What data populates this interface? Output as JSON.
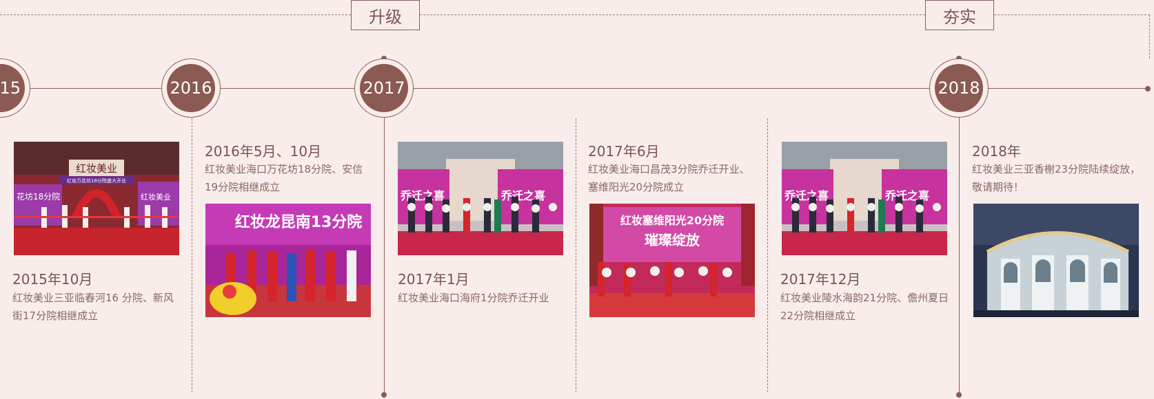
{
  "phases": [
    {
      "label": "升级"
    },
    {
      "label": "夯实"
    }
  ],
  "years": [
    "15",
    "2016",
    "2017",
    "2018"
  ],
  "events": [
    {
      "date": "2015年10月",
      "desc": "红妆美业三亚临春河16 分院、新风街17分院相继成立"
    },
    {
      "date": "2016年5月、10月",
      "desc": "红妆美业海口万花坊18分院、安信19分院相继成立"
    },
    {
      "date": "2017年1月",
      "desc": "红妆美业海口海府1分院乔迁开业"
    },
    {
      "date": "2017年6月",
      "desc": "红妆美业海口昌茂3分院乔迁开业、塞维阳光20分院成立"
    },
    {
      "date": "2017年12月",
      "desc": "红妆美业陵水海韵21分院、儋州夏日22分院相继成立"
    },
    {
      "date": "2018年",
      "desc": "红妆美业三亚香榭23分院陆续绽放，敬请期待！"
    }
  ],
  "photo_text": {
    "p2015_sign": "红妆美业",
    "p2015_banner": "红妆万花坊18分院盛大开业",
    "p2015_left": "花坊18分院",
    "p2015_right": "红妆美业",
    "p2016_banner": "红妆龙昆南13分院",
    "p2017a_left": "乔迁之喜",
    "p2017a_right": "乔迁之喜",
    "p2017b_banner": "红妆塞维阳光20分院",
    "p2017b_sub": "璀璨绽放",
    "p2017c_left": "乔迁之喜",
    "p2017c_right": "乔迁之喜"
  },
  "colors": {
    "background": "#f8edeb",
    "accent": "#8b5a52",
    "line": "#8a605b"
  }
}
